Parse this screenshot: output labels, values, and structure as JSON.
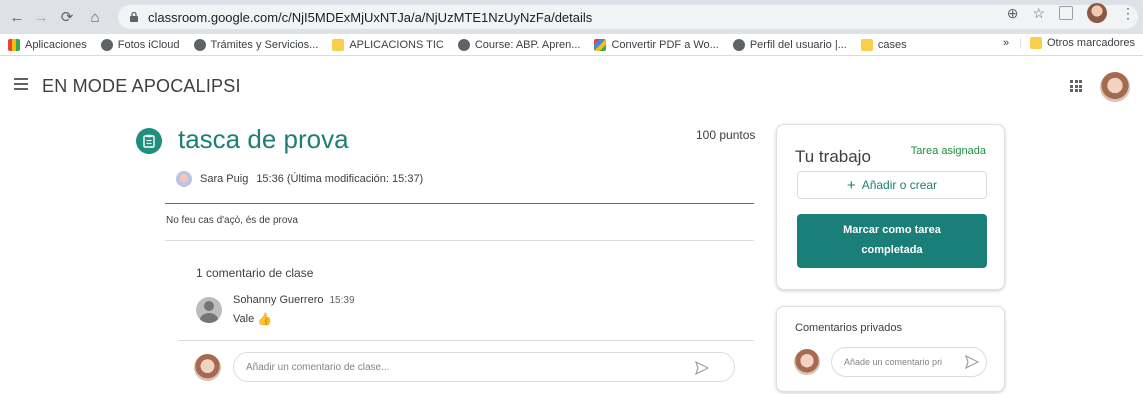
{
  "browser": {
    "url": "classroom.google.com/c/NjI5MDExMjUxNTJa/a/NjUzMTE1NzUyNzFa/details",
    "bookmarks": [
      {
        "label": "Aplicaciones",
        "icon": "apps-grid-icon"
      },
      {
        "label": "Fotos iCloud",
        "icon": "globe-icon"
      },
      {
        "label": "Trámites y Servicios...",
        "icon": "globe-icon"
      },
      {
        "label": "APLICACIONS TIC",
        "icon": "folder-icon"
      },
      {
        "label": "Course: ABP. Apren...",
        "icon": "globe-icon"
      },
      {
        "label": "Convertir PDF a Wo...",
        "icon": "colorful-app-icon"
      },
      {
        "label": "Perfil del usuario |...",
        "icon": "globe-icon"
      },
      {
        "label": "cases",
        "icon": "folder-icon"
      }
    ],
    "overflow_label": "»",
    "other_bookmarks_label": "Otros marcadores"
  },
  "header": {
    "class_title": "EN MODE APOCALIPSI"
  },
  "assignment": {
    "title": "tasca de prova",
    "points": "100 puntos",
    "author": "Sara Puig",
    "time": "15:36 (Última modificación: 15:37)",
    "description": "No feu cas d'açò, és de prova"
  },
  "class_comments": {
    "count_label": "1 comentario de clase",
    "items": [
      {
        "author": "Sohanny Guerrero",
        "time": "15:39",
        "text": "Vale"
      }
    ],
    "input_placeholder": "Añadir un comentario de clase..."
  },
  "your_work": {
    "title": "Tu trabajo",
    "status": "Tarea asignada",
    "add_label": "Añadir o crear",
    "mark_label_line1": "Marcar como tarea",
    "mark_label_line2": "completada"
  },
  "private_comments": {
    "title": "Comentarios privados",
    "input_placeholder": "Añade un comentario pri"
  },
  "colors": {
    "accent": "#1e7f74",
    "button": "#1a7f78",
    "status_green": "#1e8e3e"
  }
}
